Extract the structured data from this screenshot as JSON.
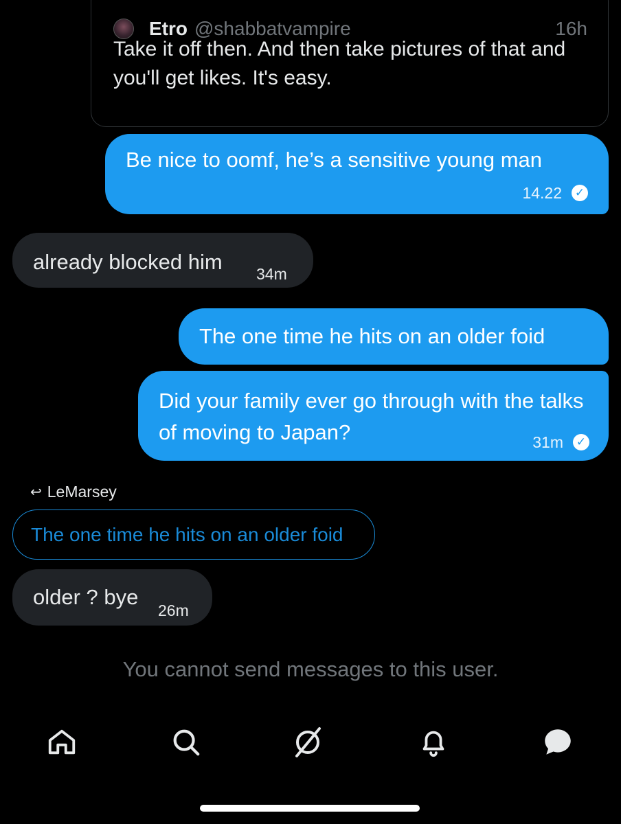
{
  "quoted_tweet": {
    "name": "Etro",
    "handle": "@shabbatvampire",
    "time": "16h",
    "text": "Take it off then. And then take pictures of that and you'll get likes. It's easy."
  },
  "messages": [
    {
      "direction": "outgoing",
      "text": "Be nice to oomf, he’s a sensitive young man",
      "time": "14.22",
      "status": "seen"
    },
    {
      "direction": "incoming",
      "text": "already blocked him",
      "time": "34m"
    },
    {
      "direction": "outgoing",
      "text": "The one time he hits on an older foid"
    },
    {
      "direction": "outgoing",
      "text": "Did your family ever go through with the talks of moving to Japan?",
      "time": "31m",
      "status": "seen"
    },
    {
      "direction": "incoming",
      "text": "older ? bye",
      "time": "26m"
    }
  ],
  "reply": {
    "label": "LeMarsey",
    "quoted_text": "The one time he hits on an older foid"
  },
  "notice": "You cannot send messages to this user.",
  "nav": [
    {
      "icon": "home-icon"
    },
    {
      "icon": "search-icon"
    },
    {
      "icon": "grok-icon"
    },
    {
      "icon": "bell-icon"
    },
    {
      "icon": "messages-icon"
    }
  ],
  "colors": {
    "background": "#000000",
    "outgoing_bubble": "#1d9bf0",
    "incoming_bubble": "#202327",
    "muted_text": "#71767b",
    "accent": "#1d9bf0"
  }
}
